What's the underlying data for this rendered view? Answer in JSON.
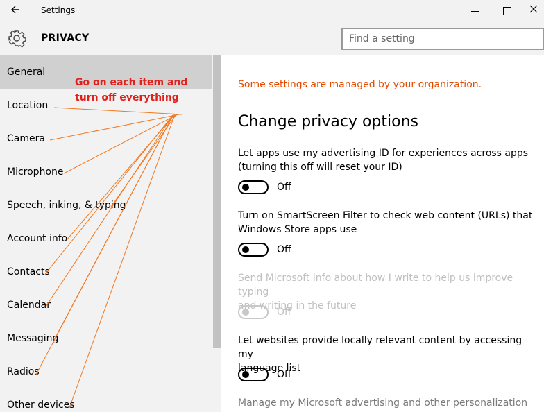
{
  "window": {
    "title": "Settings",
    "back_icon": "back-arrow-icon",
    "minimize_icon": "minimize-icon",
    "maximize_icon": "maximize-icon",
    "close_icon": "close-icon"
  },
  "header": {
    "icon": "gear-icon",
    "title": "PRIVACY",
    "search_placeholder": "Find a setting",
    "search_icon": "search-icon"
  },
  "sidebar": {
    "selected": "General",
    "items": [
      {
        "label": "General"
      },
      {
        "label": "Location"
      },
      {
        "label": "Camera"
      },
      {
        "label": "Microphone"
      },
      {
        "label": "Speech, inking, & typing"
      },
      {
        "label": "Account info"
      },
      {
        "label": "Contacts"
      },
      {
        "label": "Calendar"
      },
      {
        "label": "Messaging"
      },
      {
        "label": "Radios"
      },
      {
        "label": "Other devices"
      }
    ]
  },
  "annotation": {
    "line1": "Go on each item and",
    "line2": "turn off everything",
    "color": "#e0201a",
    "arrow_color": "#f07820"
  },
  "main": {
    "org_notice": "Some settings are managed by your organization.",
    "heading": "Change privacy options",
    "settings": [
      {
        "line1": "Let apps use my advertising ID for experiences across apps",
        "line2": "(turning this off will reset your ID)",
        "state": "Off",
        "enabled": true
      },
      {
        "line1": "Turn on SmartScreen Filter to check web content (URLs) that",
        "line2": "Windows Store apps use",
        "state": "Off",
        "enabled": true
      },
      {
        "line1": "Send Microsoft info about how I write to help us improve typing",
        "line2": "and writing in the future",
        "state": "Off",
        "enabled": false
      },
      {
        "line1": "Let websites provide locally relevant content by accessing my",
        "line2": "language list",
        "state": "Off",
        "enabled": true
      },
      {
        "line1": "Manage my Microsoft advertising and other personalization info",
        "line2": "",
        "state": "",
        "enabled": true
      }
    ]
  }
}
